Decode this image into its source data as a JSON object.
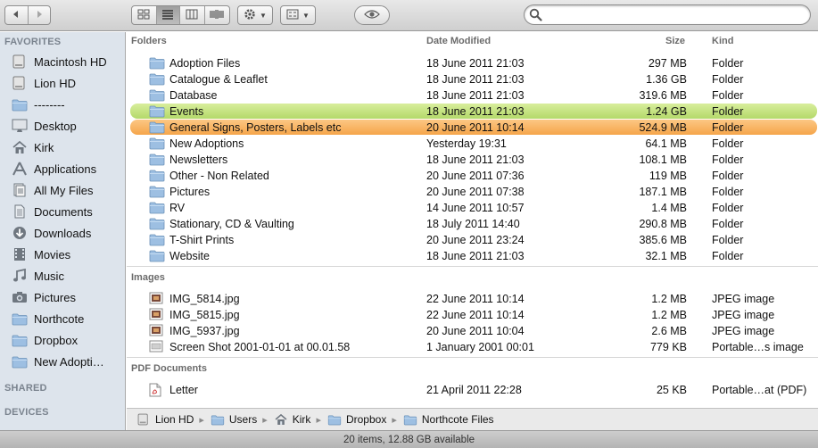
{
  "toolbar": {
    "back_icon": "back-arrow-icon",
    "forward_icon": "forward-arrow-icon",
    "view_modes": [
      "icon-view",
      "list-view",
      "column-view",
      "cover-flow-view"
    ],
    "active_view": "list-view",
    "search": {
      "placeholder": "",
      "value": ""
    }
  },
  "sidebar": {
    "favorites_heading": "FAVORITES",
    "items": [
      {
        "label": "Macintosh HD",
        "icon": "hard-drive-icon"
      },
      {
        "label": "Lion HD",
        "icon": "hard-drive-icon"
      },
      {
        "label": "--------",
        "icon": "folder-icon"
      },
      {
        "label": "Desktop",
        "icon": "desktop-icon"
      },
      {
        "label": "Kirk",
        "icon": "home-icon"
      },
      {
        "label": "Applications",
        "icon": "applications-icon"
      },
      {
        "label": "All My Files",
        "icon": "all-files-icon"
      },
      {
        "label": "Documents",
        "icon": "documents-icon"
      },
      {
        "label": "Downloads",
        "icon": "downloads-icon"
      },
      {
        "label": "Movies",
        "icon": "movies-icon"
      },
      {
        "label": "Music",
        "icon": "music-icon"
      },
      {
        "label": "Pictures",
        "icon": "camera-icon"
      },
      {
        "label": "Northcote",
        "icon": "folder-icon"
      },
      {
        "label": "Dropbox",
        "icon": "folder-icon"
      },
      {
        "label": "New Adopti…",
        "icon": "folder-icon"
      }
    ],
    "shared_heading": "SHARED",
    "devices_heading": "DEVICES"
  },
  "filelist": {
    "columns": {
      "name": "Folders",
      "date": "Date Modified",
      "size": "Size",
      "kind": "Kind"
    },
    "groups": [
      {
        "title": "Folders",
        "rows": [
          {
            "name": "Adoption Files",
            "date": "18 June 2011 21:03",
            "size": "297 MB",
            "kind": "Folder",
            "icon": "folder-icon",
            "label": ""
          },
          {
            "name": "Catalogue & Leaflet",
            "date": "18 June 2011 21:03",
            "size": "1.36 GB",
            "kind": "Folder",
            "icon": "folder-icon",
            "label": ""
          },
          {
            "name": "Database",
            "date": "18 June 2011 21:03",
            "size": "319.6 MB",
            "kind": "Folder",
            "icon": "folder-icon",
            "label": ""
          },
          {
            "name": "Events",
            "date": "18 June 2011 21:03",
            "size": "1.24 GB",
            "kind": "Folder",
            "icon": "folder-icon",
            "label": "green"
          },
          {
            "name": "General Signs, Posters, Labels etc",
            "date": "20 June 2011 10:14",
            "size": "524.9 MB",
            "kind": "Folder",
            "icon": "folder-icon",
            "label": "orange"
          },
          {
            "name": "New Adoptions",
            "date": "Yesterday 19:31",
            "size": "64.1 MB",
            "kind": "Folder",
            "icon": "folder-icon",
            "label": ""
          },
          {
            "name": "Newsletters",
            "date": "18 June 2011 21:03",
            "size": "108.1 MB",
            "kind": "Folder",
            "icon": "folder-icon",
            "label": ""
          },
          {
            "name": "Other - Non Related",
            "date": "20 June 2011 07:36",
            "size": "119 MB",
            "kind": "Folder",
            "icon": "folder-icon",
            "label": ""
          },
          {
            "name": "Pictures",
            "date": "20 June 2011 07:38",
            "size": "187.1 MB",
            "kind": "Folder",
            "icon": "folder-icon",
            "label": ""
          },
          {
            "name": "RV",
            "date": "14 June 2011 10:57",
            "size": "1.4 MB",
            "kind": "Folder",
            "icon": "folder-icon",
            "label": ""
          },
          {
            "name": "Stationary, CD & Vaulting",
            "date": "18 July 2011 14:40",
            "size": "290.8 MB",
            "kind": "Folder",
            "icon": "folder-icon",
            "label": ""
          },
          {
            "name": "T-Shirt Prints",
            "date": "20 June 2011 23:24",
            "size": "385.6 MB",
            "kind": "Folder",
            "icon": "folder-icon",
            "label": ""
          },
          {
            "name": "Website",
            "date": "18 June 2011 21:03",
            "size": "32.1 MB",
            "kind": "Folder",
            "icon": "folder-icon",
            "label": ""
          }
        ]
      },
      {
        "title": "Images",
        "rows": [
          {
            "name": "IMG_5814.jpg",
            "date": "22 June 2011 10:14",
            "size": "1.2 MB",
            "kind": "JPEG image",
            "icon": "image-file-icon",
            "label": ""
          },
          {
            "name": "IMG_5815.jpg",
            "date": "22 June 2011 10:14",
            "size": "1.2 MB",
            "kind": "JPEG image",
            "icon": "image-file-icon",
            "label": ""
          },
          {
            "name": "IMG_5937.jpg",
            "date": "20 June 2011 10:04",
            "size": "2.6 MB",
            "kind": "JPEG image",
            "icon": "image-file-icon",
            "label": ""
          },
          {
            "name": "Screen Shot 2001-01-01 at 00.01.58",
            "date": "1 January 2001 00:01",
            "size": "779 KB",
            "kind": "Portable…s image",
            "icon": "screenshot-file-icon",
            "label": ""
          }
        ]
      },
      {
        "title": "PDF Documents",
        "rows": [
          {
            "name": "Letter",
            "date": "21 April 2011 22:28",
            "size": "25 KB",
            "kind": "Portable…at (PDF)",
            "icon": "pdf-file-icon",
            "label": ""
          }
        ]
      }
    ]
  },
  "pathbar": {
    "segments": [
      {
        "label": "Lion HD",
        "icon": "hard-drive-icon"
      },
      {
        "label": "Users",
        "icon": "folder-icon"
      },
      {
        "label": "Kirk",
        "icon": "home-icon"
      },
      {
        "label": "Dropbox",
        "icon": "folder-icon"
      },
      {
        "label": "Northcote Files",
        "icon": "folder-icon"
      }
    ]
  },
  "statusbar": {
    "text": "20 items, 12.88 GB available"
  },
  "colors": {
    "label_green": "#c6e383",
    "label_orange": "#f7b25f",
    "sidebar_bg": "#dde4ec",
    "folder_blue": "#8fb7de"
  }
}
